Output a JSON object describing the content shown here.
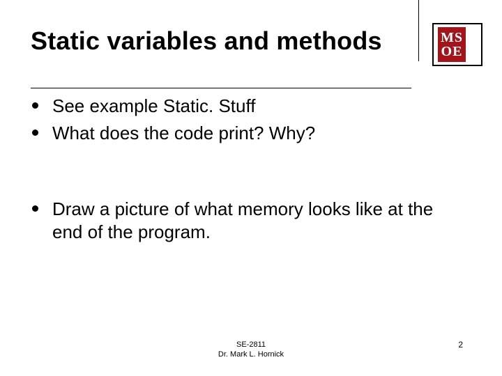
{
  "slide": {
    "title": "Static variables and methods",
    "bullets": [
      "See example Static. Stuff",
      "What does the code print? Why?",
      "Draw a picture of what memory looks like at the end of the program."
    ],
    "footer": {
      "line1": "SE-2811",
      "line2": "Dr. Mark L. Hornick",
      "page": "2"
    },
    "logo": {
      "line1": "MS",
      "line2": "OE"
    }
  }
}
